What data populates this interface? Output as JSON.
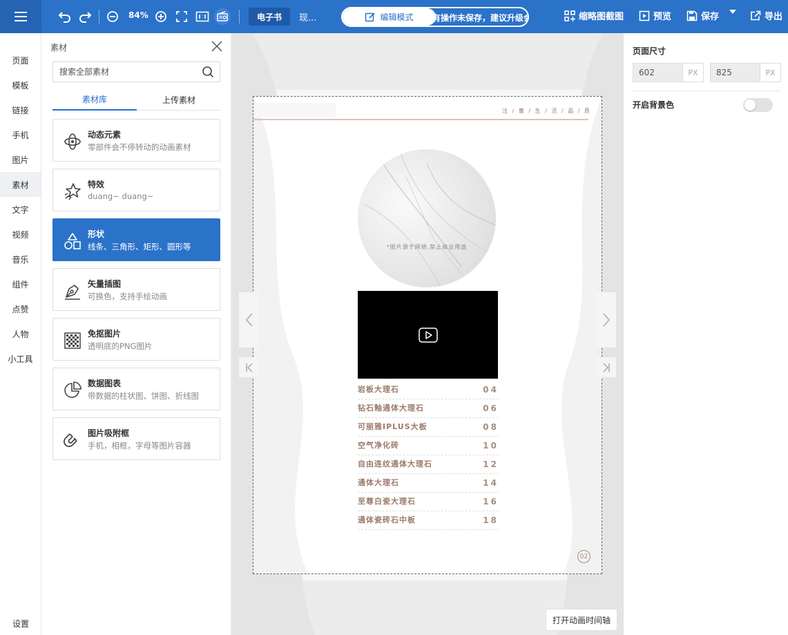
{
  "toolbar": {
    "zoom": "84%",
    "ebook_label": "电子书",
    "doc_title": "现...",
    "mode_label": "编辑模式",
    "notice": "有操作未保存，建议升级会员!",
    "thumbnail_label": "缩略图截图",
    "preview_label": "预览",
    "save_label": "保存",
    "export_label": "导出"
  },
  "nav": {
    "items": [
      "页面",
      "模板",
      "链接",
      "手机",
      "图片",
      "素材",
      "文字",
      "视频",
      "音乐",
      "组件",
      "点赞",
      "人物",
      "小工具"
    ],
    "active": "素材",
    "settings": "设置"
  },
  "panel": {
    "title": "素材",
    "search_placeholder": "搜索全部素材",
    "tabs": [
      "素材库",
      "上传素材"
    ],
    "cards": [
      {
        "icon": "dynamic-element-icon",
        "title": "动态元素",
        "desc": "零部件会不停转动的动画素材"
      },
      {
        "icon": "effect-star-icon",
        "title": "特效",
        "desc": "duang~ duang~"
      },
      {
        "icon": "shapes-icon",
        "title": "形状",
        "desc": "线条、三角形、矩形、圆形等"
      },
      {
        "icon": "pen-nib-icon",
        "title": "矢量插图",
        "desc": "可换色，支持手绘动画"
      },
      {
        "icon": "transparent-image-icon",
        "title": "免抠图片",
        "desc": "透明底的PNG图片"
      },
      {
        "icon": "pie-chart-icon",
        "title": "数据图表",
        "desc": "带数据的柱状图、饼图、折线图"
      },
      {
        "icon": "magnet-icon",
        "title": "图片吸附框",
        "desc": "手机，相框，字母等图片容器"
      }
    ],
    "active_card": "形状"
  },
  "page": {
    "header": "注 / 曹 / 生 / 活 / 品 / 质",
    "photo_note": "*图片源于网络,禁止商业用途",
    "toc": [
      {
        "name": "岩板大理石",
        "page": "04"
      },
      {
        "name": "钻石釉通体大理石",
        "page": "06"
      },
      {
        "name": "可丽雅IPLUS大板",
        "page": "08"
      },
      {
        "name": "空气净化砖",
        "page": "10"
      },
      {
        "name": "自由连纹通体大理石",
        "page": "12"
      },
      {
        "name": "通体大理石",
        "page": "14"
      },
      {
        "name": "至尊白瓷大理石",
        "page": "16"
      },
      {
        "name": "通体瓷砖石中板",
        "page": "18"
      }
    ],
    "page_number": "02"
  },
  "right": {
    "size_title": "页面尺寸",
    "width": "602",
    "height": "825",
    "unit": "PX",
    "bg_label": "开启背景色",
    "bg_enabled": false
  },
  "timeline_button": "打开动画时间轴",
  "colors": {
    "primary": "#2b72c9",
    "accent_brown": "#9c7b6a"
  }
}
